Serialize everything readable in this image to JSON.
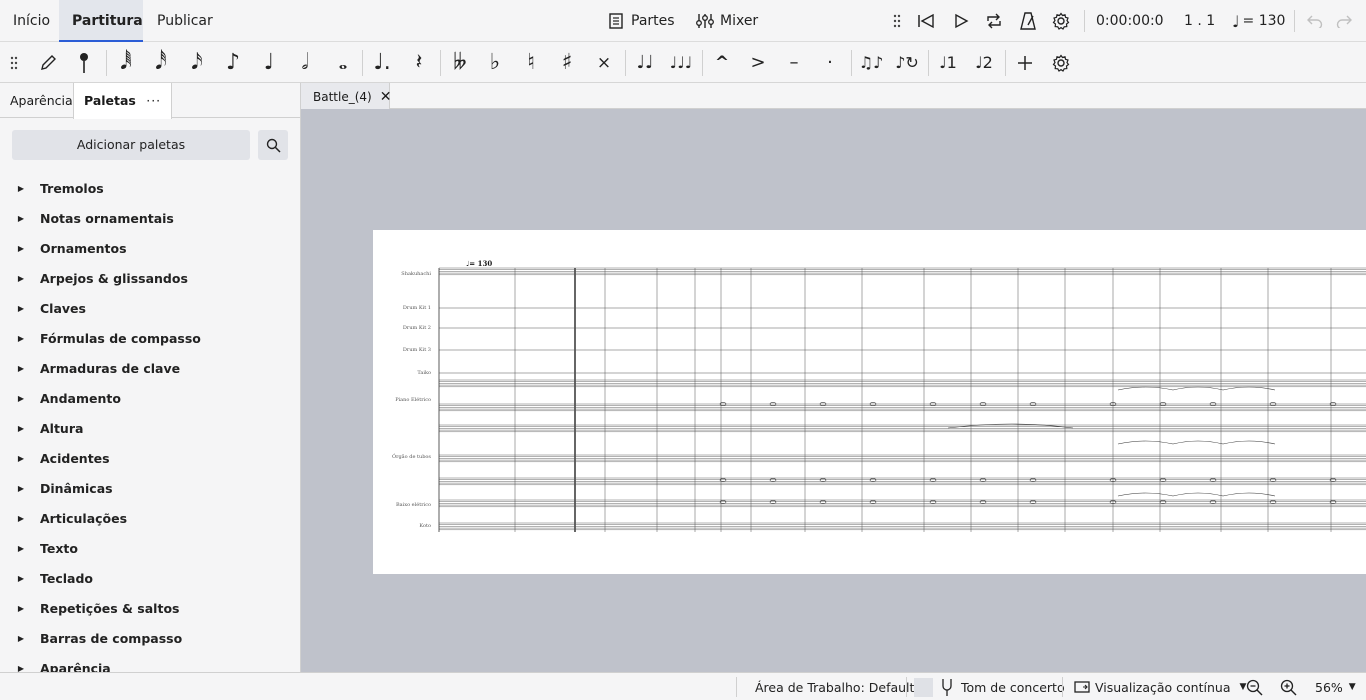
{
  "tabs": [
    {
      "label": "Início"
    },
    {
      "label": "Partitura"
    },
    {
      "label": "Publicar"
    }
  ],
  "header": {
    "parts_label": "Partes",
    "mixer_label": "Mixer",
    "time": "0:00:00:0",
    "position": "1 . 1",
    "tempo": "= 130"
  },
  "palettes": {
    "tab_appearance": "Aparência",
    "tab_palettes": "Paletas",
    "more": "···",
    "add_button": "Adicionar paletas",
    "items": [
      "Tremolos",
      "Notas ornamentais",
      "Ornamentos",
      "Arpejos & glissandos",
      "Claves",
      "Fórmulas de compasso",
      "Armaduras de clave",
      "Andamento",
      "Altura",
      "Acidentes",
      "Dinâmicas",
      "Articulações",
      "Texto",
      "Teclado",
      "Repetições & saltos",
      "Barras de compasso",
      "Aparência"
    ]
  },
  "document": {
    "tab_label": "Battle_(4)",
    "tempo_marking": "♩= 130",
    "instruments": [
      "Shakuhachi",
      "Drum Kit 1",
      "Drum Kit 2",
      "Drum Kit 3",
      "Taiko",
      "Piano Elétrico",
      "Órgão de tubos",
      "Baixo elétrico",
      "Koto"
    ]
  },
  "status": {
    "workspace": "Área de Trabalho: Default",
    "concert_pitch": "Tom de concerto",
    "view_mode": "Visualização contínua",
    "zoom": "56%"
  }
}
